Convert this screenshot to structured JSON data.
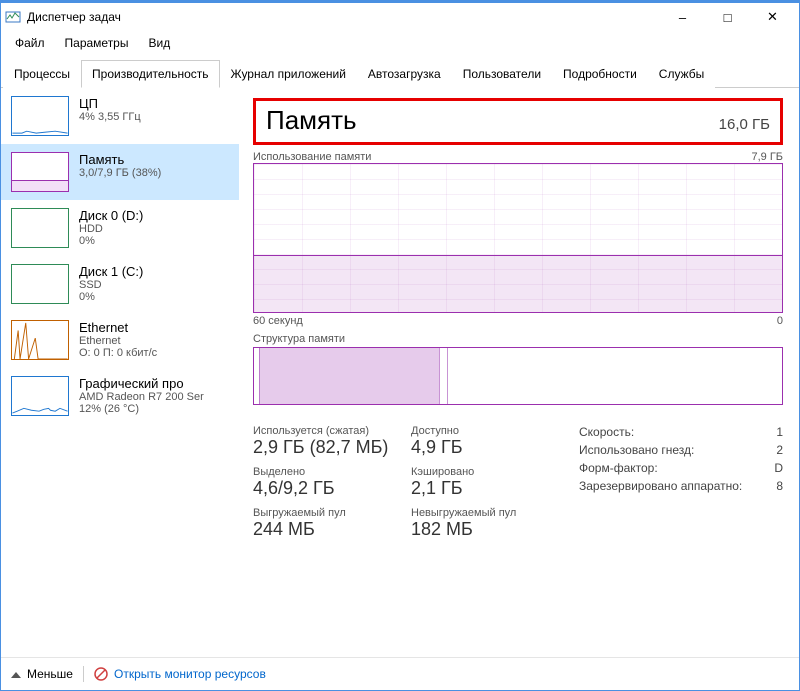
{
  "window": {
    "title": "Диспетчер задач"
  },
  "menu": {
    "file": "Файл",
    "options": "Параметры",
    "view": "Вид"
  },
  "tabs": {
    "processes": "Процессы",
    "performance": "Производительность",
    "appHistory": "Журнал приложений",
    "startup": "Автозагрузка",
    "users": "Пользователи",
    "details": "Подробности",
    "services": "Службы"
  },
  "sidebar": {
    "cpu": {
      "title": "ЦП",
      "sub": "4%  3,55 ГГц"
    },
    "memory": {
      "title": "Память",
      "sub": "3,0/7,9 ГБ (38%)"
    },
    "disk0": {
      "title": "Диск 0 (D:)",
      "sub1": "HDD",
      "sub2": "0%"
    },
    "disk1": {
      "title": "Диск 1 (C:)",
      "sub1": "SSD",
      "sub2": "0%"
    },
    "ethernet": {
      "title": "Ethernet",
      "sub1": "Ethernet",
      "sub2": "О: 0  П: 0 кбит/с"
    },
    "gpu": {
      "title": "Графический про",
      "sub1": "AMD Radeon R7 200 Ser",
      "sub2": "12%  (26 °C)"
    }
  },
  "header": {
    "title": "Память",
    "total": "16,0 ГБ"
  },
  "chart": {
    "topLeft": "Использование памяти",
    "topRight": "7,9 ГБ",
    "bottomLeft": "60 секунд",
    "bottomRight": "0",
    "structLabel": "Структура памяти"
  },
  "stats": {
    "inUse": {
      "label": "Используется (сжатая)",
      "value": "2,9 ГБ (82,7 МБ)"
    },
    "available": {
      "label": "Доступно",
      "value": "4,9 ГБ"
    },
    "committed": {
      "label": "Выделено",
      "value": "4,6/9,2 ГБ"
    },
    "cached": {
      "label": "Кэшировано",
      "value": "2,1 ГБ"
    },
    "pagedPool": {
      "label": "Выгружаемый пул",
      "value": "244 МБ"
    },
    "nonPagedPool": {
      "label": "Невыгружаемый пул",
      "value": "182 МБ"
    }
  },
  "info": {
    "speed": {
      "label": "Скорость:",
      "value": "1"
    },
    "slots": {
      "label": "Использовано гнезд:",
      "value": "2"
    },
    "form": {
      "label": "Форм-фактор:",
      "value": "D"
    },
    "reserved": {
      "label": "Зарезервировано аппаратно:",
      "value": "8"
    }
  },
  "footer": {
    "fewer": "Меньше",
    "resmon": "Открыть монитор ресурсов"
  },
  "chart_data": {
    "type": "line",
    "title": "Использование памяти",
    "ylabel": "ГБ",
    "ylim": [
      0,
      7.9
    ],
    "x_seconds_range": [
      60,
      0
    ],
    "series": [
      {
        "name": "Память",
        "values": [
          3.0,
          3.0,
          3.0,
          3.0,
          3.0,
          3.0,
          3.0,
          3.0,
          3.0,
          3.0,
          3.0,
          3.0
        ]
      }
    ]
  }
}
